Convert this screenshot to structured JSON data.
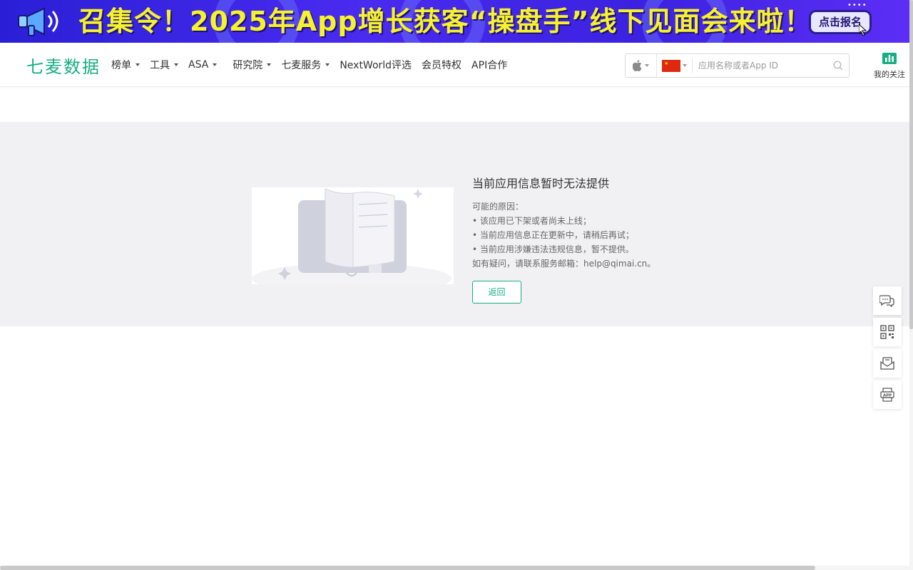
{
  "banner": {
    "headline": "召集令！2025年App增长获客“操盘手”线下见面会来啦！",
    "cta_label": "点击报名",
    "dots": "••••"
  },
  "header": {
    "logo": "七麦数据",
    "nav": [
      {
        "label": "榜单",
        "dropdown": true
      },
      {
        "label": "工具",
        "dropdown": true
      },
      {
        "label": "ASA",
        "dropdown": true
      },
      {
        "label": "研究院",
        "dropdown": true
      },
      {
        "label": "七麦服务",
        "dropdown": true
      },
      {
        "label": "NextWorld评选",
        "dropdown": false
      },
      {
        "label": "会员特权",
        "dropdown": false
      },
      {
        "label": "API合作",
        "dropdown": false
      }
    ],
    "search": {
      "platform_icon": "apple-icon",
      "country_icon": "china-flag-icon",
      "placeholder": "应用名称或者App ID",
      "value": ""
    },
    "follow_label": "我的关注"
  },
  "content": {
    "title": "当前应用信息暂时无法提供",
    "reasons_heading": "可能的原因：",
    "reasons": [
      "• 该应用已下架或者尚未上线；",
      "• 当前应用信息正在更新中，请稍后再试；",
      "• 当前应用涉嫌违法违规信息，暂不提供。"
    ],
    "contact": "如有疑问，请联系服务邮箱：help@qimai.cn。",
    "back_label": "返回"
  },
  "float_bar": [
    "chat-icon",
    "qrcode-icon",
    "mail-icon",
    "app-download-icon"
  ],
  "colors": {
    "brand": "#17ad84",
    "banner_bg": "#3b22e0",
    "banner_text": "#f7f32a",
    "band_bg": "#f1f1f3"
  }
}
